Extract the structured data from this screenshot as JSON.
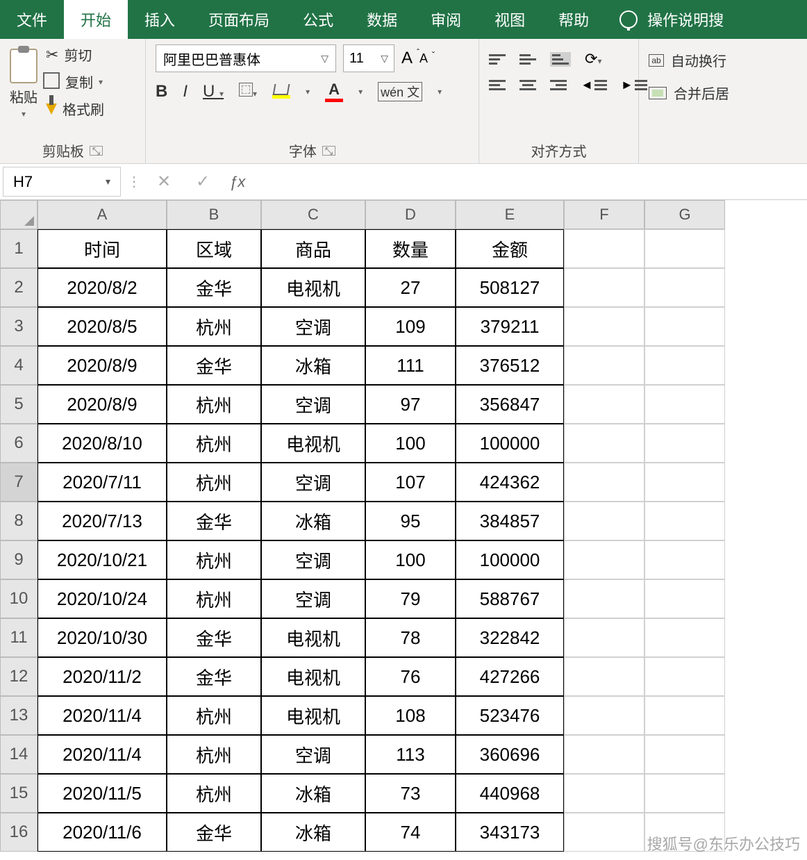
{
  "ribbon": {
    "tabs": [
      "文件",
      "开始",
      "插入",
      "页面布局",
      "公式",
      "数据",
      "审阅",
      "视图",
      "帮助"
    ],
    "active": 1,
    "tell_me": "操作说明搜",
    "clipboard": {
      "paste": "粘贴",
      "cut": "剪切",
      "copy": "复制",
      "format_painter": "格式刷",
      "group": "剪贴板"
    },
    "font": {
      "name": "阿里巴巴普惠体",
      "size": "11",
      "group": "字体",
      "wen": "wén 文"
    },
    "align": {
      "group": "对齐方式",
      "wrap": "自动换行",
      "merge": "合并后居"
    }
  },
  "namebox": "H7",
  "columns": [
    "A",
    "B",
    "C",
    "D",
    "E",
    "F",
    "G"
  ],
  "headers": [
    "时间",
    "区域",
    "商品",
    "数量",
    "金额"
  ],
  "rows": [
    {
      "n": 1,
      "d": [
        "时间",
        "区域",
        "商品",
        "数量",
        "金额"
      ]
    },
    {
      "n": 2,
      "d": [
        "2020/8/2",
        "金华",
        "电视机",
        "27",
        "508127"
      ]
    },
    {
      "n": 3,
      "d": [
        "2020/8/5",
        "杭州",
        "空调",
        "109",
        "379211"
      ]
    },
    {
      "n": 4,
      "d": [
        "2020/8/9",
        "金华",
        "冰箱",
        "111",
        "376512"
      ]
    },
    {
      "n": 5,
      "d": [
        "2020/8/9",
        "杭州",
        "空调",
        "97",
        "356847"
      ]
    },
    {
      "n": 6,
      "d": [
        "2020/8/10",
        "杭州",
        "电视机",
        "100",
        "100000"
      ]
    },
    {
      "n": 7,
      "d": [
        "2020/7/11",
        "杭州",
        "空调",
        "107",
        "424362"
      ]
    },
    {
      "n": 8,
      "d": [
        "2020/7/13",
        "金华",
        "冰箱",
        "95",
        "384857"
      ]
    },
    {
      "n": 9,
      "d": [
        "2020/10/21",
        "杭州",
        "空调",
        "100",
        "100000"
      ]
    },
    {
      "n": 10,
      "d": [
        "2020/10/24",
        "杭州",
        "空调",
        "79",
        "588767"
      ]
    },
    {
      "n": 11,
      "d": [
        "2020/10/30",
        "金华",
        "电视机",
        "78",
        "322842"
      ]
    },
    {
      "n": 12,
      "d": [
        "2020/11/2",
        "金华",
        "电视机",
        "76",
        "427266"
      ]
    },
    {
      "n": 13,
      "d": [
        "2020/11/4",
        "杭州",
        "电视机",
        "108",
        "523476"
      ]
    },
    {
      "n": 14,
      "d": [
        "2020/11/4",
        "杭州",
        "空调",
        "113",
        "360696"
      ]
    },
    {
      "n": 15,
      "d": [
        "2020/11/5",
        "杭州",
        "冰箱",
        "73",
        "440968"
      ]
    },
    {
      "n": 16,
      "d": [
        "2020/11/6",
        "金华",
        "冰箱",
        "74",
        "343173"
      ]
    }
  ],
  "selected_row": 7,
  "watermark": "搜狐号@东乐办公技巧"
}
